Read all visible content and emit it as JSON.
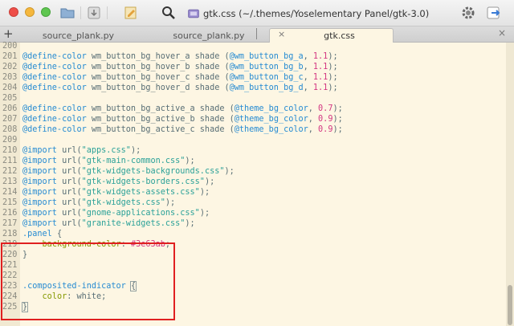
{
  "window": {
    "title": "gtk.css (~/.themes/Yoselementary Panel/gtk-3.0)"
  },
  "tabs": [
    {
      "label": "source_plank.py"
    },
    {
      "label": "source_plank.py"
    },
    {
      "label": "gtk.css",
      "close": "×"
    }
  ],
  "tabbar": {
    "plus": "+",
    "close": "×"
  },
  "icons": {
    "folder": "folder-icon",
    "download": "download-icon",
    "edit": "edit-icon",
    "search": "search-icon",
    "file": "file-icon",
    "gear": "gear-icon",
    "export": "export-icon"
  },
  "colors": {
    "background": "#fdf6e3",
    "keyword": "#268bd2",
    "string": "#2aa198",
    "number": "#d33682",
    "text": "#586e75",
    "highlight": "#e02020"
  },
  "lines": [
    {
      "n": "200",
      "parts": []
    },
    {
      "n": "201",
      "parts": [
        [
          "kw",
          "@define-color"
        ],
        [
          "t",
          " wm_button_bg_hover_a shade ("
        ],
        [
          "kw",
          "@wm_button_bg_a"
        ],
        [
          "t",
          ", "
        ],
        [
          "num",
          "1.1"
        ],
        [
          "t",
          ");"
        ]
      ]
    },
    {
      "n": "202",
      "parts": [
        [
          "kw",
          "@define-color"
        ],
        [
          "t",
          " wm_button_bg_hover_b shade ("
        ],
        [
          "kw",
          "@wm_button_bg_b"
        ],
        [
          "t",
          ", "
        ],
        [
          "num",
          "1.1"
        ],
        [
          "t",
          ");"
        ]
      ]
    },
    {
      "n": "203",
      "parts": [
        [
          "kw",
          "@define-color"
        ],
        [
          "t",
          " wm_button_bg_hover_c shade ("
        ],
        [
          "kw",
          "@wm_button_bg_c"
        ],
        [
          "t",
          ", "
        ],
        [
          "num",
          "1.1"
        ],
        [
          "t",
          ");"
        ]
      ]
    },
    {
      "n": "204",
      "parts": [
        [
          "kw",
          "@define-color"
        ],
        [
          "t",
          " wm_button_bg_hover_d shade ("
        ],
        [
          "kw",
          "@wm_button_bg_d"
        ],
        [
          "t",
          ", "
        ],
        [
          "num",
          "1.1"
        ],
        [
          "t",
          ");"
        ]
      ]
    },
    {
      "n": "205",
      "parts": []
    },
    {
      "n": "206",
      "parts": [
        [
          "kw",
          "@define-color"
        ],
        [
          "t",
          " wm_button_bg_active_a shade ("
        ],
        [
          "kw",
          "@theme_bg_color"
        ],
        [
          "t",
          ", "
        ],
        [
          "num",
          "0.7"
        ],
        [
          "t",
          ");"
        ]
      ]
    },
    {
      "n": "207",
      "parts": [
        [
          "kw",
          "@define-color"
        ],
        [
          "t",
          " wm_button_bg_active_b shade ("
        ],
        [
          "kw",
          "@theme_bg_color"
        ],
        [
          "t",
          ", "
        ],
        [
          "num",
          "0.9"
        ],
        [
          "t",
          ");"
        ]
      ]
    },
    {
      "n": "208",
      "parts": [
        [
          "kw",
          "@define-color"
        ],
        [
          "t",
          " wm_button_bg_active_c shade ("
        ],
        [
          "kw",
          "@theme_bg_color"
        ],
        [
          "t",
          ", "
        ],
        [
          "num",
          "0.9"
        ],
        [
          "t",
          ");"
        ]
      ]
    },
    {
      "n": "209",
      "parts": []
    },
    {
      "n": "210",
      "parts": [
        [
          "kw",
          "@import"
        ],
        [
          "t",
          " url("
        ],
        [
          "str",
          "\"apps.css\""
        ],
        [
          "t",
          ");"
        ]
      ]
    },
    {
      "n": "211",
      "parts": [
        [
          "kw",
          "@import"
        ],
        [
          "t",
          " url("
        ],
        [
          "str",
          "\"gtk-main-common.css\""
        ],
        [
          "t",
          ");"
        ]
      ]
    },
    {
      "n": "212",
      "parts": [
        [
          "kw",
          "@import"
        ],
        [
          "t",
          " url("
        ],
        [
          "str",
          "\"gtk-widgets-backgrounds.css\""
        ],
        [
          "t",
          ");"
        ]
      ]
    },
    {
      "n": "213",
      "parts": [
        [
          "kw",
          "@import"
        ],
        [
          "t",
          " url("
        ],
        [
          "str",
          "\"gtk-widgets-borders.css\""
        ],
        [
          "t",
          ");"
        ]
      ]
    },
    {
      "n": "214",
      "parts": [
        [
          "kw",
          "@import"
        ],
        [
          "t",
          " url("
        ],
        [
          "str",
          "\"gtk-widgets-assets.css\""
        ],
        [
          "t",
          ");"
        ]
      ]
    },
    {
      "n": "215",
      "parts": [
        [
          "kw",
          "@import"
        ],
        [
          "t",
          " url("
        ],
        [
          "str",
          "\"gtk-widgets.css\""
        ],
        [
          "t",
          ");"
        ]
      ]
    },
    {
      "n": "216",
      "parts": [
        [
          "kw",
          "@import"
        ],
        [
          "t",
          " url("
        ],
        [
          "str",
          "\"gnome-applications.css\""
        ],
        [
          "t",
          ");"
        ]
      ]
    },
    {
      "n": "217",
      "parts": [
        [
          "kw",
          "@import"
        ],
        [
          "t",
          " url("
        ],
        [
          "str",
          "\"granite-widgets.css\""
        ],
        [
          "t",
          ");"
        ]
      ]
    },
    {
      "n": "218",
      "parts": [
        [
          "kw",
          ".panel"
        ],
        [
          "t",
          " {"
        ]
      ]
    },
    {
      "n": "219",
      "parts": [
        [
          "t",
          "    "
        ],
        [
          "fn",
          "background-color"
        ],
        [
          "t",
          ": "
        ],
        [
          "num",
          "#3e63ab"
        ],
        [
          "t",
          ";"
        ]
      ]
    },
    {
      "n": "220",
      "parts": [
        [
          "t",
          "}"
        ]
      ]
    },
    {
      "n": "221",
      "parts": []
    },
    {
      "n": "222",
      "parts": []
    },
    {
      "n": "223",
      "parts": [
        [
          "kw",
          ".composited-indicator"
        ],
        [
          "t",
          " "
        ],
        [
          "box",
          "{"
        ]
      ]
    },
    {
      "n": "224",
      "parts": [
        [
          "t",
          "    "
        ],
        [
          "fn",
          "color"
        ],
        [
          "t",
          ": white;"
        ]
      ]
    },
    {
      "n": "225",
      "parts": [
        [
          "box",
          "}"
        ]
      ]
    }
  ]
}
